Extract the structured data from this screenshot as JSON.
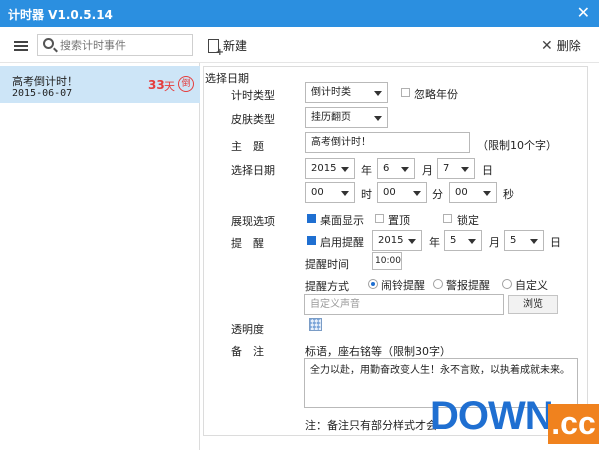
{
  "window": {
    "title": "计时器 V1.0.5.14",
    "close_glyph": "✕"
  },
  "toolbar": {
    "search_placeholder": "搜索计时事件",
    "new_label": "新建",
    "delete_label": "删除"
  },
  "sidebar": {
    "items": [
      {
        "name": "高考倒计时！",
        "date": "2015-06-07",
        "days": "33",
        "unit": "天",
        "badge": "倒"
      }
    ]
  },
  "form": {
    "section_title": "选择日期",
    "timer_type": {
      "label": "计时类型",
      "value": "倒计时类",
      "ignore_year_label": "忽略年份",
      "ignore_year_checked": false
    },
    "skin_type": {
      "label": "皮肤类型",
      "value": "挂历翻页"
    },
    "subject": {
      "label": "主　题",
      "value": "高考倒计时！",
      "limit_hint": "（限制10个字）"
    },
    "select_date": {
      "label": "选择日期",
      "year": "2015",
      "year_unit": "年",
      "month": "6",
      "month_unit": "月",
      "day": "7",
      "day_unit": "日"
    },
    "time": {
      "hour": "00",
      "hour_unit": "时",
      "minute": "00",
      "minute_unit": "分",
      "second": "00",
      "second_unit": "秒"
    },
    "display": {
      "label": "展现选项",
      "desktop_label": "桌面显示",
      "desktop_checked": true,
      "top_label": "置顶",
      "top_checked": false,
      "lock_label": "锁定",
      "lock_checked": false
    },
    "reminder": {
      "label": "提　醒",
      "enable_label": "启用提醒",
      "enable_checked": true,
      "year": "2015",
      "year_unit": "年",
      "month": "5",
      "month_unit": "月",
      "day": "5",
      "day_unit": "日"
    },
    "reminder_time": {
      "label": "提醒时间",
      "value": "10:00"
    },
    "reminder_mode": {
      "label": "提醒方式",
      "options": [
        "闹铃提醒",
        "警报提醒",
        "自定义"
      ],
      "selected": 0
    },
    "custom_sound": {
      "placeholder": "自定义声音",
      "browse_label": "浏览"
    },
    "opacity": {
      "label": "透明度"
    },
    "remark": {
      "label": "备　注",
      "hint": "标语，座右铭等（限制30字）",
      "value": "全力以赴，用勤奋改变人生！永不言败，以执着成就未来。"
    },
    "footnote": "注：备注只有部分样式才会"
  },
  "watermark": {
    "brand": "DOWN",
    "suffix": ".cc"
  },
  "colors": {
    "titlebar": "#2b8fe0",
    "selection": "#cde5f7",
    "accent_red": "#e53e3e",
    "check_blue": "#1f6fd1"
  }
}
